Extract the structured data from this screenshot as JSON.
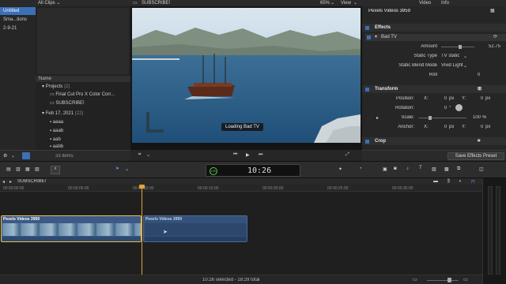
{
  "library": {
    "items": [
      {
        "label": "Untitled",
        "selected": true
      },
      {
        "label": "Sma...tions",
        "selected": false
      },
      {
        "label": "2-9-21",
        "selected": false
      }
    ]
  },
  "browser": {
    "filter_label": "All Clips",
    "name_header": "Name",
    "groups": [
      {
        "label": "Projects",
        "count": "(2)",
        "items": [
          "Final Cut Pro X Color Corr...",
          "SUBSCRIBE!"
        ]
      },
      {
        "label": "Feb 17, 2021",
        "count": "(22)",
        "items": [
          "aaaa",
          "aaab",
          "aab",
          "aabb"
        ]
      }
    ],
    "item_count": "33 items"
  },
  "viewer": {
    "title": "SUBSCRIBE!",
    "zoom": "65%",
    "view_label": "View",
    "overlay_text": "Loading Bad TV"
  },
  "inspector": {
    "clip_name": "Pexels Videos 3959",
    "tabs": [
      "Video",
      "Info"
    ],
    "effects_label": "Effects",
    "effect_name": "Bad TV",
    "params": [
      {
        "label": "Amount",
        "value": "52.75"
      },
      {
        "label": "Static Type",
        "value": "TV static"
      },
      {
        "label": "Static Blend Mode",
        "value": "Vivid Light"
      },
      {
        "label": "Roll",
        "value": "0"
      }
    ],
    "transform_label": "Transform",
    "transform": [
      {
        "label": "Position:",
        "axis1": "X:",
        "v1": "0",
        "unit1": "px",
        "axis2": "Y:",
        "v2": "0",
        "unit2": "px"
      },
      {
        "label": "Rotation:",
        "v1": "0",
        "unit1": "°"
      },
      {
        "label": "Scale:",
        "v1": "100",
        "unit1": "%"
      },
      {
        "label": "Anchor:",
        "axis1": "X:",
        "v1": "0",
        "unit1": "px",
        "axis2": "Y:",
        "v2": "0",
        "unit2": "px"
      }
    ],
    "crop_label": "Crop",
    "save_preset": "Save Effects Preset"
  },
  "toolbar": {
    "timecode": "10:26",
    "tc_small": "100"
  },
  "timeline": {
    "project": "SUBSCRIBE!",
    "ruler": [
      "00:00:00:00",
      "00:00:05:00",
      "00:00:10:00",
      "00:00:15:00",
      "00:00:20:00",
      "00:00:25:00",
      "00:00:30:00"
    ],
    "clip1": "Pexels Videos 3959",
    "clip2": "Pexels Videos 3959",
    "status": "10:26 selected - 18:29 total"
  },
  "colors": {
    "accent": "#5b9cff",
    "selection": "#3b6fb6",
    "clip": "#3d5a86",
    "playhead": "#e8a13a"
  }
}
